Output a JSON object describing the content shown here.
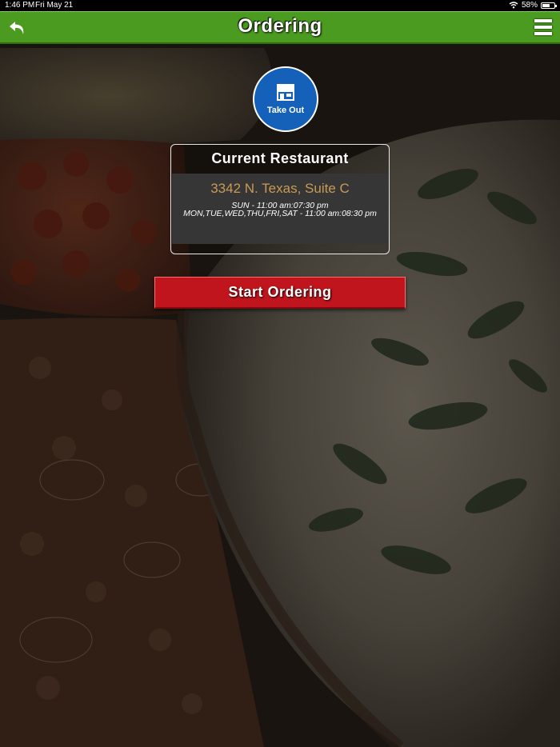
{
  "status_bar": {
    "time": "1:46 PM",
    "date": "Fri May 21",
    "battery": "58%",
    "battery_level": 0.58
  },
  "header": {
    "title": "Ordering",
    "back_icon": "back-arrow-icon",
    "menu_icon": "hamburger-menu-icon",
    "color": "#4a9b20"
  },
  "order_type": {
    "label": "Take Out",
    "icon": "storefront-icon",
    "color": "#1560b8"
  },
  "restaurant": {
    "heading": "Current Restaurant",
    "address": "3342 N. Texas, Suite C",
    "hours": [
      "SUN - 11:00 am:07:30 pm",
      "MON,TUE,WED,THU,FRI,SAT - 11:00 am:08:30 pm"
    ],
    "address_color": "#c99a56"
  },
  "actions": {
    "start_label": "Start Ordering",
    "start_color": "#c0151c"
  }
}
